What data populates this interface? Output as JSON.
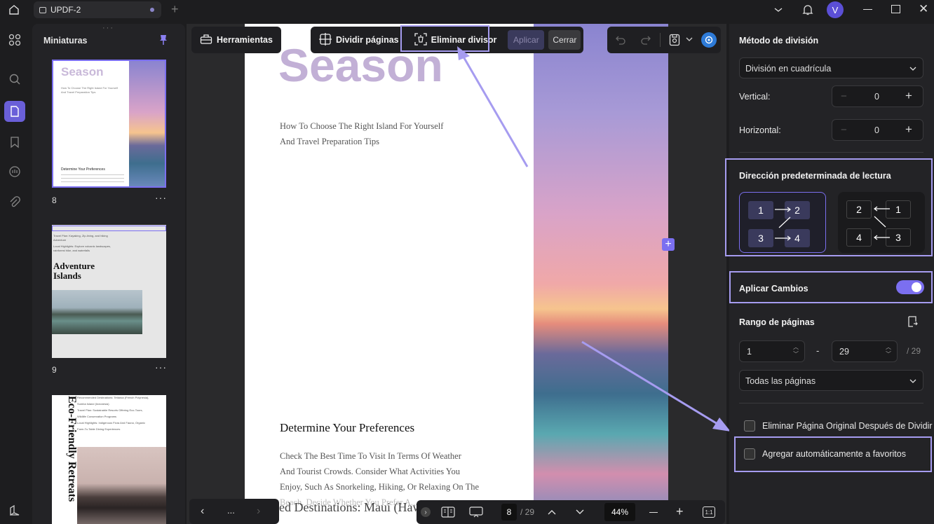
{
  "app": {
    "tab_title": "UPDF-2",
    "avatar_letter": "V"
  },
  "thumbnails": {
    "title": "Miniaturas",
    "pages": [
      {
        "number": "8",
        "heading": "Season",
        "sub1": "How To Choose The Right Island For Yourself",
        "sub2": "And Travel Preparation Tips",
        "section": "Determine Your Preferences"
      },
      {
        "number": "9",
        "lines": [
          "Travel Plan: Kayaking, Zip-lining, and hiking",
          "Adventure",
          "Local Highlights: Explore volcanic landscapes,",
          "rainforest hike, and waterfalls"
        ],
        "heading": "Adventure Islands"
      },
      {
        "heading": "Eco-Friendly Retreats",
        "lines": [
          "Recommended Destinations: Tetiaroa (French Polynesia),",
          "Sumba Island (Indonesia)",
          "Travel Plan: Sustainable Resorts Offering Eco-Tours,",
          "Wildlife Conservation Programs",
          "Local Highlights: Indigenous Flora And Fauna, Organic",
          "Farm-To-Table Dining Experiences"
        ]
      }
    ]
  },
  "toolbar": {
    "herramientas": "Herramientas",
    "dividir": "Dividir páginas",
    "eliminar": "Eliminar divisor",
    "aplicar": "Aplicar",
    "cerrar": "Cerrar"
  },
  "document": {
    "title": "Season",
    "subtitle_1": "How To Choose The Right Island For Yourself",
    "subtitle_2": "And Travel Preparation Tips",
    "section": "Determine Your Preferences",
    "body": [
      "Check The Best Time To Visit In Terms Of Weather",
      "And Tourist Crowds. Consider What Activities You",
      "Enjoy, Such As Snorkeling, Hiking, Or Relaxing On The",
      "Beach. Decide Whether You Prefer A..."
    ],
    "overlay_text": "ded Destinations: Maui (Haw"
  },
  "panel": {
    "method_label": "Método de división",
    "method_value": "División en cuadrícula",
    "vertical_label": "Vertical:",
    "vertical_value": "0",
    "horizontal_label": "Horizontal:",
    "horizontal_value": "0",
    "direction_label": "Dirección predeterminada de lectura",
    "dir_a": [
      "1",
      "2",
      "3",
      "4"
    ],
    "dir_b": [
      "2",
      "1",
      "4",
      "3"
    ],
    "apply_changes_label": "Aplicar Cambios",
    "apply_changes_on": true,
    "range_label": "Rango de páginas",
    "range_from": "1",
    "range_sep": "-",
    "range_to": "29",
    "range_total": "/ 29",
    "pages_select": "Todas las páginas",
    "option_1": "Eliminar Página Original Después de Dividir",
    "option_2": "Agregar automáticamente a favoritos"
  },
  "bottombar": {
    "more": "...",
    "page_current": "8",
    "page_total": "/ 29",
    "zoom": "44%"
  },
  "colors": {
    "accent": "#7b6ff0",
    "highlight": "#a69cf0",
    "bg": "#1d1d1f"
  }
}
